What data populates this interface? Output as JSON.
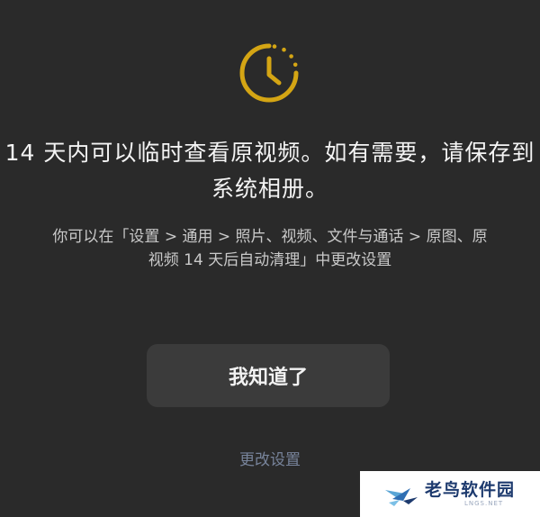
{
  "icon": "clock-icon",
  "accent_color": "#d4a514",
  "title_lines": [
    "14 天内可以临时查看原视频。如有需要，请保存到",
    "系统相册。"
  ],
  "description_lines": [
    "你可以在「设置 > 通用 > 照片、视频、文件与通话 > 原图、原",
    "视频 14 天后自动清理」中更改设置"
  ],
  "primary_button": "我知道了",
  "secondary_link": "更改设置",
  "watermark": {
    "name": "老鸟软件园",
    "sub": "LNGS.NET"
  }
}
